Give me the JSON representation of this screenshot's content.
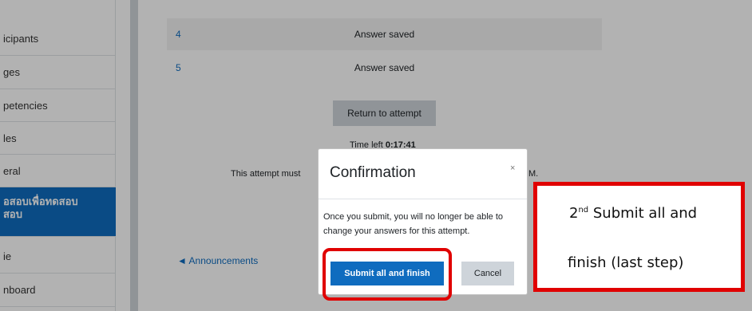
{
  "sidebar": {
    "items": [
      {
        "label": "icipants"
      },
      {
        "label": "ges"
      },
      {
        "label": "petencies"
      },
      {
        "label": "les"
      },
      {
        "label": "eral"
      },
      {
        "label": "อสอบเพื่อทดสอบ",
        "label2": "สอบ",
        "active": true
      },
      {
        "label": "ie"
      },
      {
        "label": "nboard"
      }
    ]
  },
  "summary": {
    "rows": [
      {
        "number": "4",
        "status": "Answer saved"
      },
      {
        "number": "5",
        "status": "Answer saved"
      }
    ],
    "return_button": "Return to attempt",
    "time_left_label": "Time left",
    "time_left_value": "0:17:41",
    "attempt_note": "This attempt must",
    "attempt_note_tail": "M.",
    "announcements_link": "◄ Announcements"
  },
  "modal": {
    "title": "Confirmation",
    "close_glyph": "×",
    "body": "Once you submit, you will no longer be able to change your answers for this attempt.",
    "submit_label": "Submit all and finish",
    "cancel_label": "Cancel"
  },
  "callout": {
    "ordinal": "2",
    "ordinal_suffix": "nd",
    "line1": " Submit all and",
    "line2": "finish (last step)"
  },
  "colors": {
    "accent": "#0f6cbf",
    "annotation_red": "#e00000"
  }
}
